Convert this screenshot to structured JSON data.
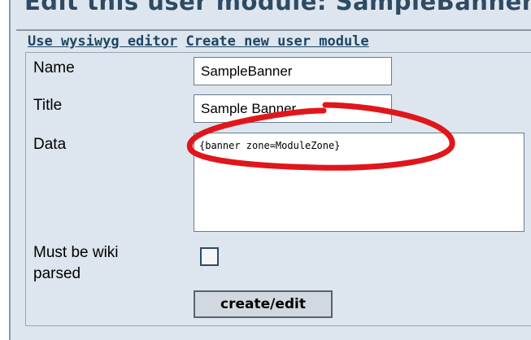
{
  "page": {
    "heading": "Edit this user module: SampleBanner",
    "links": {
      "wysiwyg": "Use wysiwyg editor",
      "create_new": "Create new user module"
    }
  },
  "form": {
    "name_label": "Name",
    "name_value": "SampleBanner",
    "title_label": "Title",
    "title_value": "Sample Banner",
    "data_label": "Data",
    "data_value": "{banner zone=ModuleZone}",
    "wiki_label_line1": "Must be wiki",
    "wiki_label_line2": "parsed",
    "wiki_checked": false,
    "submit_label": "create/edit"
  },
  "annotation": {
    "color": "#e0161b"
  },
  "colors": {
    "background": "#dde6ee",
    "link": "#1f4563",
    "heading": "#2f4a63"
  }
}
